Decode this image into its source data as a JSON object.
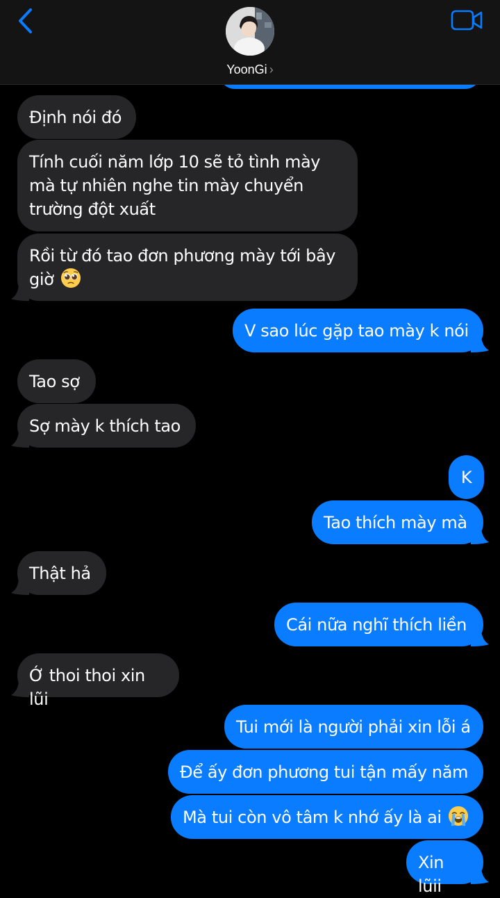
{
  "header": {
    "contact_name": "YoonGi",
    "chevron": "›"
  },
  "icons": {
    "back": "chevron-left-icon",
    "video": "video-camera-icon",
    "pleading": "pleading-face-emoji",
    "crying": "loudly-crying-face-emoji"
  },
  "colors": {
    "accent": "#0a7cff",
    "incoming_bubble": "#262629",
    "background": "#000000",
    "header": "#141414"
  },
  "messages": [
    {
      "from": "them",
      "text": "Định nói đó"
    },
    {
      "from": "them",
      "text": "Tính cuối năm lớp 10 sẽ tỏ tình mày mà tự nhiên nghe tin mày chuyển trường đột xuất"
    },
    {
      "from": "them",
      "text": "Rồi từ đó tao đơn phương mày tới bây giờ",
      "emoji": "pleading-face"
    },
    {
      "from": "me",
      "text": "V sao lúc gặp tao mày k nói"
    },
    {
      "from": "them",
      "text": "Tao sợ"
    },
    {
      "from": "them",
      "text": "Sợ mày k thích tao"
    },
    {
      "from": "me",
      "text": "K"
    },
    {
      "from": "me",
      "text": "Tao thích mày mà"
    },
    {
      "from": "them",
      "text": "Thật hả"
    },
    {
      "from": "me",
      "text": "Cái nữa nghĩ thích liền"
    },
    {
      "from": "them",
      "text": "Ớ thoi thoi xin lũi"
    },
    {
      "from": "me",
      "text": "Tui mới là người phải xin lỗi á"
    },
    {
      "from": "me",
      "text": "Để ấy đơn phương tui tận mấy năm"
    },
    {
      "from": "me",
      "text": "Mà tui còn vô tâm k nhớ ấy là ai",
      "emoji": "loudly-crying-face"
    },
    {
      "from": "me",
      "text": "Xin lũii"
    }
  ]
}
